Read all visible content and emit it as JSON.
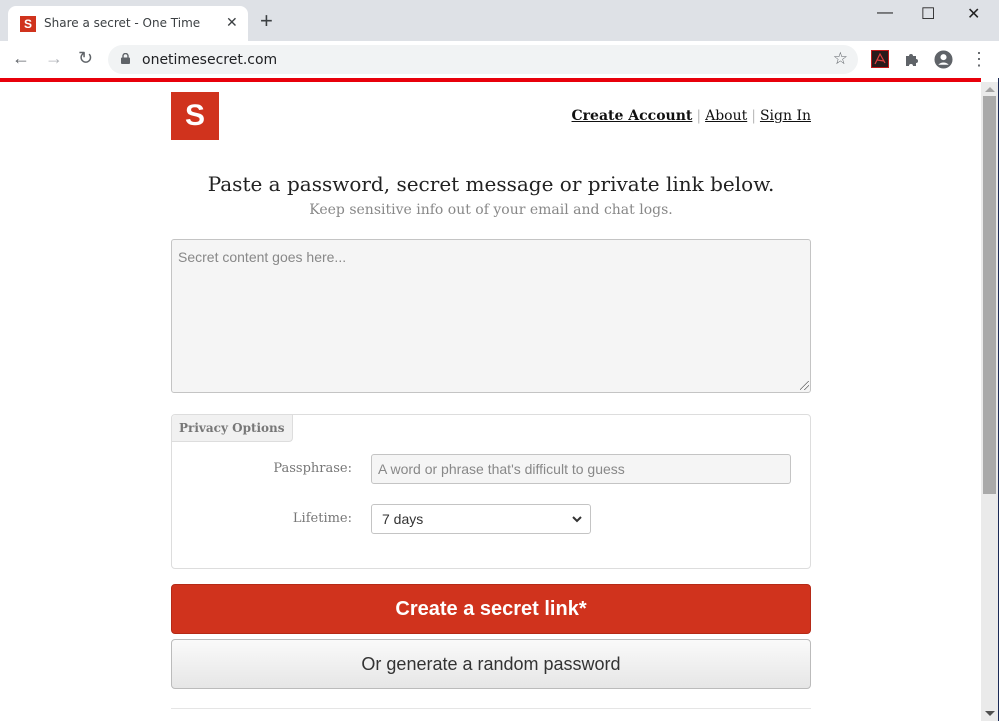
{
  "browser": {
    "tab_title": "Share a secret - One Time",
    "tab_favicon": "S",
    "close_tab_glyph": "✕",
    "new_tab_glyph": "+",
    "url": "onetimesecret.com",
    "window_controls": {
      "minimize": "—",
      "maximize": "☐",
      "close": "✕"
    },
    "nav": {
      "back": "←",
      "forward": "→",
      "reload": "↻"
    },
    "star_glyph": "☆",
    "menu_glyph": "⋮",
    "accent_color": "#e8000b"
  },
  "header": {
    "logo_letter": "S",
    "brand_color": "#d0331d",
    "nav": {
      "create_account": "Create Account",
      "about": "About",
      "sign_in": "Sign In",
      "separator": "|"
    }
  },
  "main": {
    "headline": "Paste a password, secret message or private link below.",
    "subheadline": "Keep sensitive info out of your email and chat logs.",
    "secret_placeholder": "Secret content goes here...",
    "secret_value": "",
    "privacy_options": {
      "title": "Privacy Options",
      "passphrase_label": "Passphrase:",
      "passphrase_placeholder": "A word or phrase that's difficult to guess",
      "passphrase_value": "",
      "lifetime_label": "Lifetime:",
      "lifetime_selected": "7 days"
    },
    "create_button": "Create a secret link*",
    "generate_button": "Or generate a random password"
  }
}
